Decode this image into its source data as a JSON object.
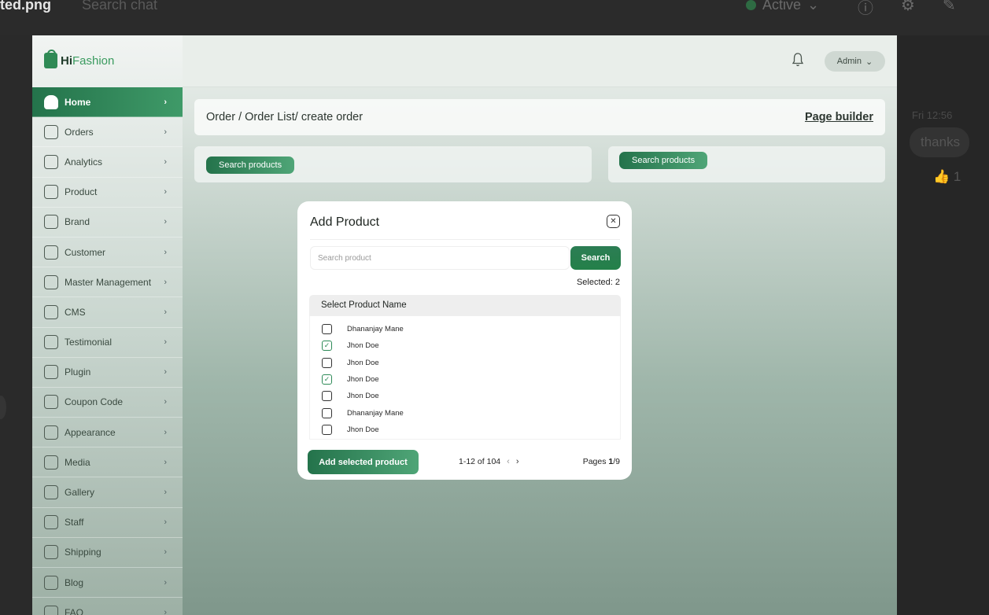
{
  "outer": {
    "filename": "ted.png",
    "search_placeholder": "Search chat",
    "status": "Active",
    "time": "Fri 12:56",
    "message": "thanks",
    "reaction_count": "1"
  },
  "brand": {
    "hi": "Hi",
    "fashion": "Fashion",
    "accent": "#2f8a55"
  },
  "header": {
    "admin_label": "Admin"
  },
  "sidebar": {
    "items": [
      {
        "label": "Home",
        "icon": "home-icon"
      },
      {
        "label": "Orders",
        "icon": "orders-icon"
      },
      {
        "label": "Analytics",
        "icon": "analytics-icon"
      },
      {
        "label": "Product",
        "icon": "product-icon"
      },
      {
        "label": "Brand",
        "icon": "brand-icon"
      },
      {
        "label": "Customer",
        "icon": "customer-icon"
      },
      {
        "label": "Master Management",
        "icon": "master-icon"
      },
      {
        "label": "CMS",
        "icon": "cms-icon"
      },
      {
        "label": "Testimonial",
        "icon": "testimonial-icon"
      },
      {
        "label": "Plugin",
        "icon": "plugin-icon"
      },
      {
        "label": "Coupon Code",
        "icon": "coupon-icon"
      },
      {
        "label": "Appearance",
        "icon": "appearance-icon"
      },
      {
        "label": "Media",
        "icon": "media-icon"
      },
      {
        "label": "Gallery",
        "icon": "gallery-icon"
      },
      {
        "label": "Staff",
        "icon": "staff-icon"
      },
      {
        "label": "Shipping",
        "icon": "shipping-icon"
      },
      {
        "label": "Blog",
        "icon": "blog-icon"
      },
      {
        "label": "FAQ",
        "icon": "faq-icon"
      }
    ]
  },
  "main": {
    "breadcrumb": "Order / Order List/ create order",
    "page_builder": "Page builder",
    "left_search_label": "Search products",
    "right_search_label": "Search products"
  },
  "modal": {
    "title": "Add Product",
    "search_placeholder": "Search product",
    "search_button": "Search",
    "selected_text": "Selected: 2",
    "list_header": "Select Product Name",
    "products": [
      {
        "name": "Dhananjay Mane",
        "checked": false
      },
      {
        "name": "Jhon Doe",
        "checked": true
      },
      {
        "name": "Jhon Doe",
        "checked": false
      },
      {
        "name": "Jhon Doe",
        "checked": true
      },
      {
        "name": "Jhon Doe",
        "checked": false
      },
      {
        "name": "Dhananjay Mane",
        "checked": false
      },
      {
        "name": "Jhon Doe",
        "checked": false
      }
    ],
    "add_button": "Add selected product",
    "range_text": "1-12 of 104",
    "pages_label": "Pages ",
    "pages_current": "1",
    "pages_total": "/9"
  }
}
